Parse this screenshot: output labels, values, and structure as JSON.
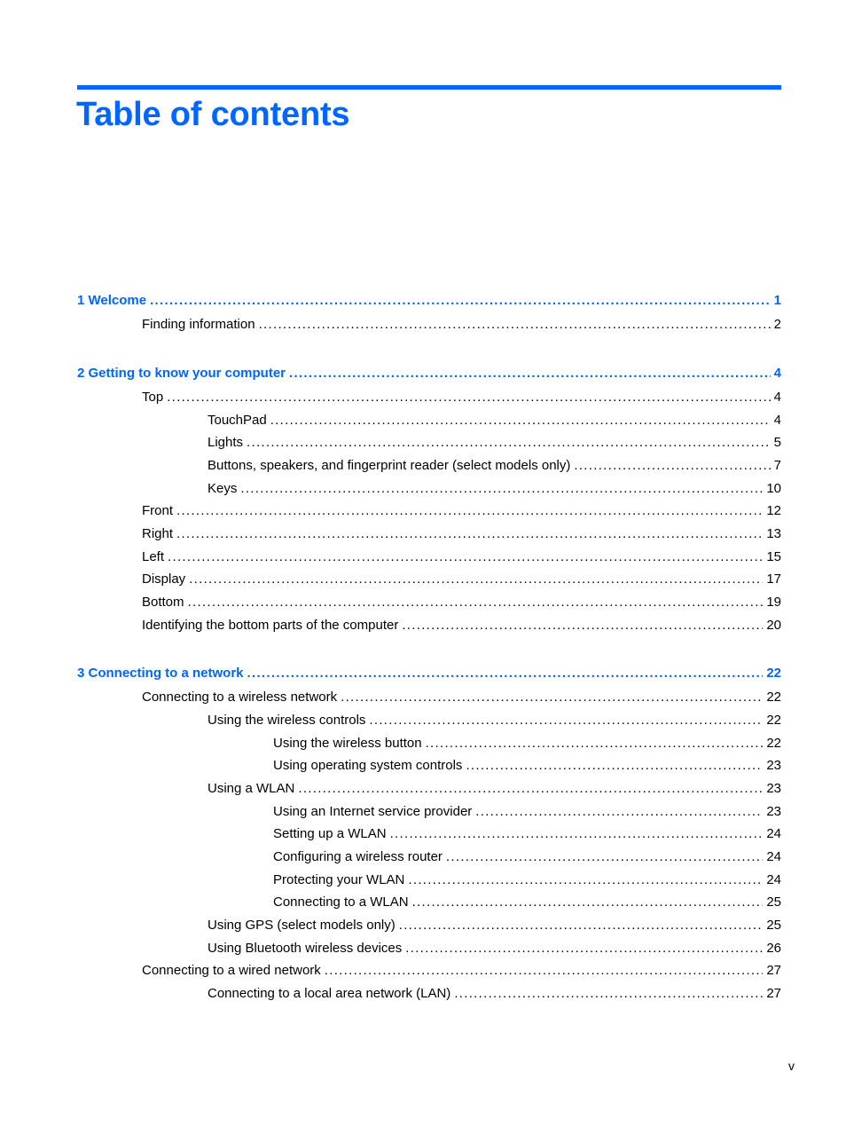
{
  "header": {
    "title": "Table of contents",
    "accent_color": "#0066ff"
  },
  "toc": [
    {
      "level": 1,
      "label": "1  Welcome",
      "page": "1"
    },
    {
      "level": 2,
      "label": "Finding information",
      "page": "2"
    },
    {
      "level": 1,
      "label": "2  Getting to know your computer",
      "page": "4"
    },
    {
      "level": 2,
      "label": "Top",
      "page": "4"
    },
    {
      "level": 3,
      "label": "TouchPad",
      "page": "4"
    },
    {
      "level": 3,
      "label": "Lights",
      "page": "5"
    },
    {
      "level": 3,
      "label": "Buttons, speakers, and fingerprint reader (select models only)",
      "page": "7"
    },
    {
      "level": 3,
      "label": "Keys",
      "page": "10"
    },
    {
      "level": 2,
      "label": "Front",
      "page": "12"
    },
    {
      "level": 2,
      "label": "Right",
      "page": "13"
    },
    {
      "level": 2,
      "label": "Left",
      "page": "15"
    },
    {
      "level": 2,
      "label": "Display",
      "page": "17"
    },
    {
      "level": 2,
      "label": "Bottom",
      "page": "19"
    },
    {
      "level": 2,
      "label": "Identifying the bottom parts of the computer",
      "page": "20"
    },
    {
      "level": 1,
      "label": "3  Connecting to a network",
      "page": "22"
    },
    {
      "level": 2,
      "label": "Connecting to a wireless network",
      "page": "22"
    },
    {
      "level": 3,
      "label": "Using the wireless controls",
      "page": "22"
    },
    {
      "level": 4,
      "label": "Using the wireless button",
      "page": "22"
    },
    {
      "level": 4,
      "label": "Using operating system controls",
      "page": "23"
    },
    {
      "level": 3,
      "label": "Using a WLAN",
      "page": "23"
    },
    {
      "level": 4,
      "label": "Using an Internet service provider",
      "page": "23"
    },
    {
      "level": 4,
      "label": "Setting up a WLAN",
      "page": "24"
    },
    {
      "level": 4,
      "label": "Configuring a wireless router",
      "page": "24"
    },
    {
      "level": 4,
      "label": "Protecting your WLAN",
      "page": "24"
    },
    {
      "level": 4,
      "label": "Connecting to a WLAN",
      "page": "25"
    },
    {
      "level": 3,
      "label": "Using GPS (select models only)",
      "page": "25"
    },
    {
      "level": 3,
      "label": "Using Bluetooth wireless devices",
      "page": "26"
    },
    {
      "level": 2,
      "label": "Connecting to a wired network",
      "page": "27"
    },
    {
      "level": 3,
      "label": "Connecting to a local area network (LAN)",
      "page": "27"
    }
  ],
  "footer": {
    "page_number": "v"
  }
}
